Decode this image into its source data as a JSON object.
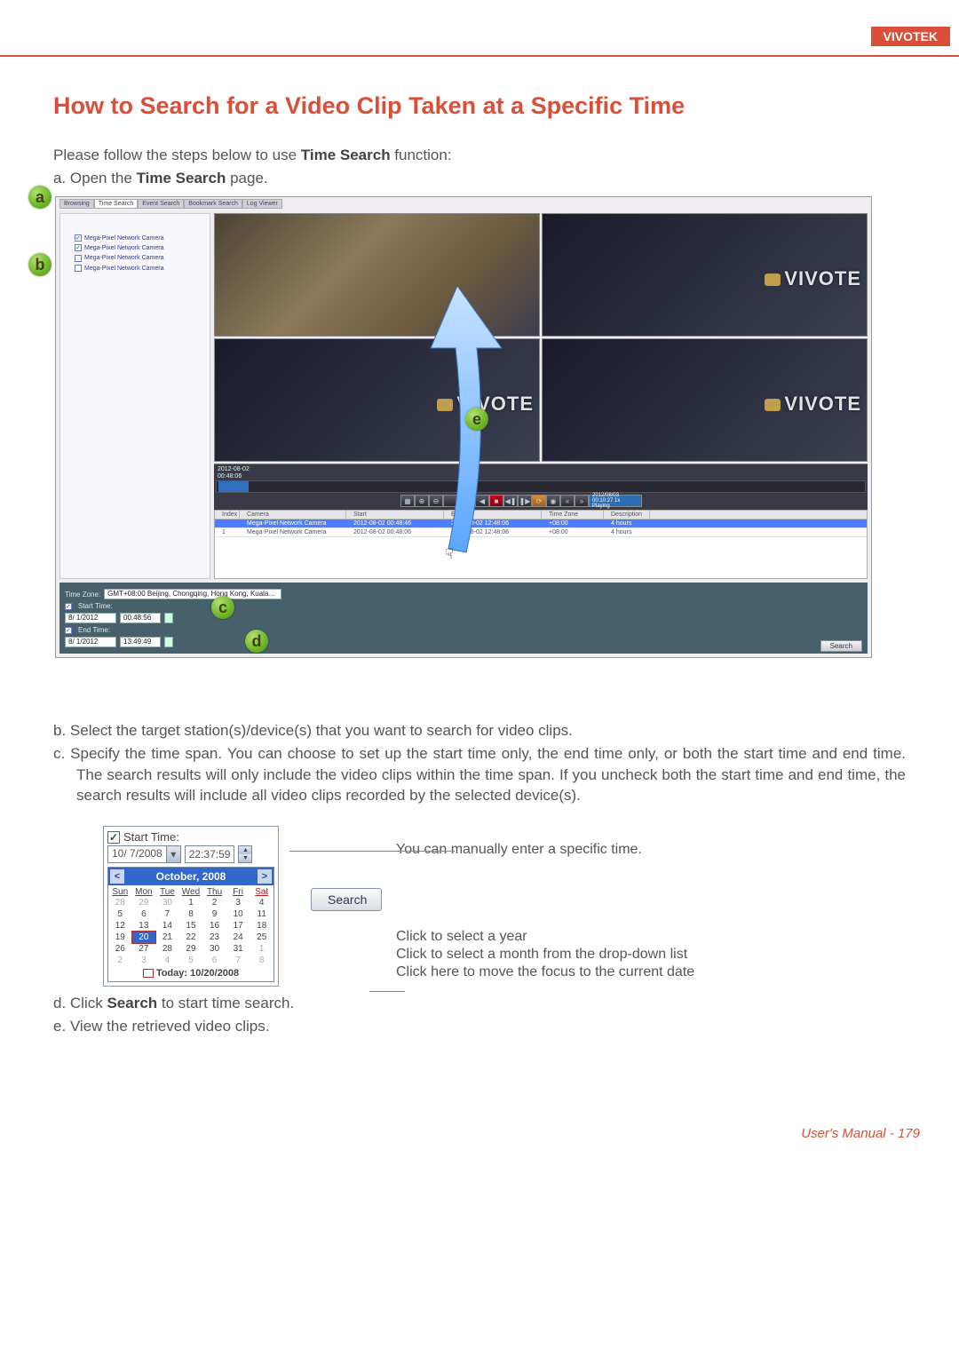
{
  "brand": "VIVOTEK",
  "footer": "User's Manual - 179",
  "heading": "How to Search for a Video Clip Taken at a Specific Time",
  "intro_prefix": "Please follow the steps below to use ",
  "intro_bold": "Time Search",
  "intro_suffix": " function:",
  "step_a_prefix": "a. Open the ",
  "step_a_bold": "Time Search",
  "step_a_suffix": " page.",
  "bullets": {
    "a": "a",
    "b": "b",
    "c": "c",
    "d": "d",
    "e": "e"
  },
  "screenshot": {
    "tabs": [
      "Browsing",
      "Time Search",
      "Event Search",
      "Bookmark Search",
      "Log Viewer"
    ],
    "tree": [
      {
        "checked": true,
        "label": "Mega-Pixel Network Camera"
      },
      {
        "checked": true,
        "label": "Mega-Pixel Network Camera"
      },
      {
        "checked": false,
        "label": "Mega-Pixel Network Camera"
      },
      {
        "checked": false,
        "label": "Mega-Pixel Network Camera"
      }
    ],
    "watermark": "VIVOTE",
    "timeline": {
      "date": "2012-08-02",
      "time": "00:48:06",
      "clock": "2012/08/03 00:10:27  1x  Playing"
    },
    "results": {
      "headers": [
        "Index",
        "Camera",
        "Start",
        "End",
        "Time Zone",
        "Description"
      ],
      "rows": [
        {
          "sel": true,
          "cells": [
            "",
            "Mega-Pixel Network Camera",
            "2012-08-02 00:48:46",
            "2012-08-02 12:48:06",
            "+08:00",
            "4 hours"
          ]
        },
        {
          "sel": false,
          "cells": [
            "1",
            "Mega-Pixel Network Camera",
            "2012-08-02 00:48:06",
            "2012-08-02 12:48:06",
            "+08:00",
            "4 hours"
          ]
        }
      ]
    },
    "bottom": {
      "tz_label": "Time Zone:",
      "tz_value": "GMT+08:00 Beijing, Chongqing, Hong Kong, Kuala…",
      "start_label": "Start Time:",
      "start_date": "8/ 1/2012",
      "start_time": "00:48:56",
      "end_label": "End Time:",
      "end_date": "8/ 1/2012",
      "end_time": "13:49:49",
      "search": "Search"
    }
  },
  "step_b": "b. Select the target station(s)/device(s) that you want to search for video clips.",
  "step_c": "c. Specify the time span. You can choose to set up the start time only, the end time only, or both the start time and end time. The search results will only include the video clips within the time span. If you uncheck both the start time and end time, the search results will include all video clips recorded by the selected device(s).",
  "calendar": {
    "start_label": "Start Time:",
    "date_value": "10/ 7/2008",
    "time_value": "22:37:59",
    "month_title": "October, 2008",
    "dow": [
      "Sun",
      "Mon",
      "Tue",
      "Wed",
      "Thu",
      "Fri",
      "Sat"
    ],
    "days": [
      [
        "28",
        "29",
        "30",
        "1",
        "2",
        "3",
        "4"
      ],
      [
        "5",
        "6",
        "7",
        "8",
        "9",
        "10",
        "11"
      ],
      [
        "12",
        "13",
        "14",
        "15",
        "16",
        "17",
        "18"
      ],
      [
        "19",
        "20",
        "21",
        "22",
        "23",
        "24",
        "25"
      ],
      [
        "26",
        "27",
        "28",
        "29",
        "30",
        "31",
        "1"
      ],
      [
        "2",
        "3",
        "4",
        "5",
        "6",
        "7",
        "8"
      ]
    ],
    "today_label": "Today: 10/20/2008",
    "search": "Search"
  },
  "callouts": {
    "manual": "You can manually enter a specific time.",
    "year": "Click to select a year",
    "month": "Click to select a month from the drop-down list",
    "today": "Click here to move the focus to the current date"
  },
  "step_d_prefix": "d. Click ",
  "step_d_bold": "Search",
  "step_d_suffix": " to start time search.",
  "step_e": "e. View the retrieved video clips."
}
